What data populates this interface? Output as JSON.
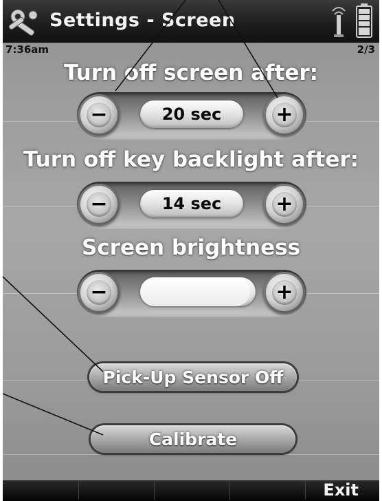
{
  "header": {
    "title": "Settings - Screen",
    "app_icon": "tools-icon",
    "signal_icon": "antenna-icon",
    "battery_icon": "battery-icon"
  },
  "status": {
    "time": "7:36am",
    "page_indicator": "2/3"
  },
  "screen_timeout": {
    "label": "Turn off screen after:",
    "value": "20 sec",
    "decrease_glyph": "−",
    "increase_glyph": "+"
  },
  "key_backlight": {
    "label": "Turn off key backlight after:",
    "value": "14 sec",
    "decrease_glyph": "−",
    "increase_glyph": "+"
  },
  "brightness": {
    "label": "Screen brightness",
    "level_fraction": 0.95,
    "decrease_glyph": "−",
    "increase_glyph": "+"
  },
  "actions": {
    "pickup_sensor": "Pick-Up Sensor Off",
    "calibrate": "Calibrate"
  },
  "softkeys": {
    "right": "Exit"
  },
  "colors": {
    "titlebar": "#1e1e1e",
    "background": "#a0a0a0",
    "heading_text": "#ffffff"
  }
}
